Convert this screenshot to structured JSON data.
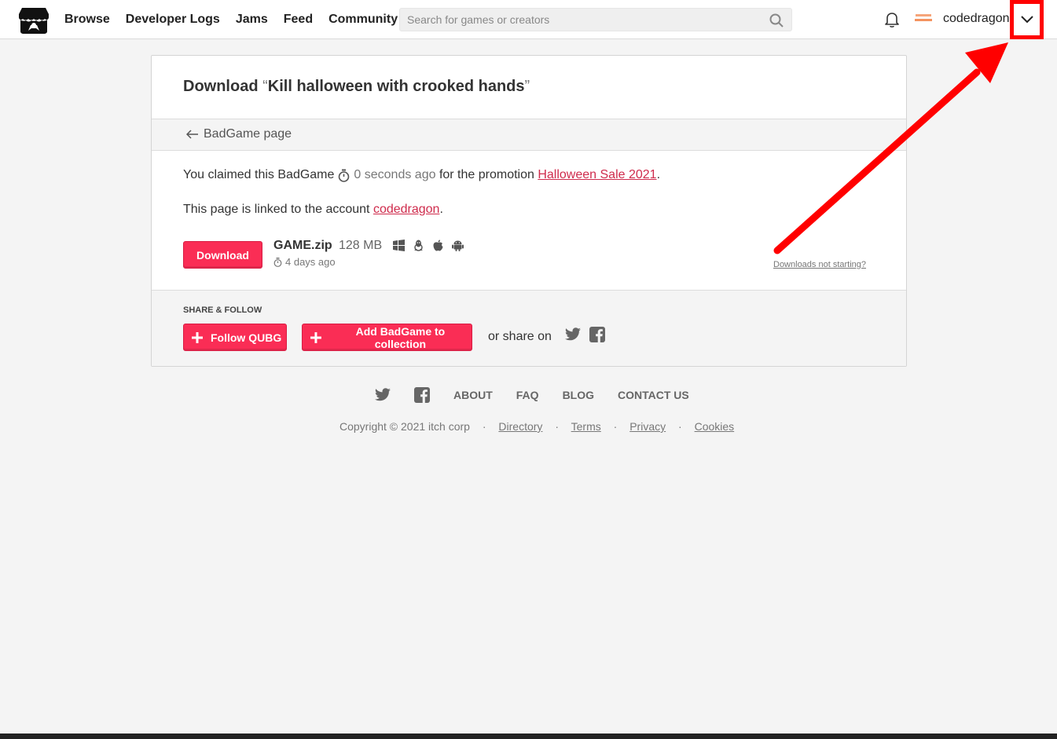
{
  "nav": {
    "items": [
      {
        "label": "Browse"
      },
      {
        "label": "Developer Logs"
      },
      {
        "label": "Jams"
      },
      {
        "label": "Feed"
      },
      {
        "label": "Community"
      }
    ]
  },
  "search": {
    "placeholder": "Search for games or creators"
  },
  "user": {
    "name": "codedragon"
  },
  "page": {
    "title_prefix": "Download ",
    "open_quote": "“",
    "game_title": "Kill halloween with crooked hands",
    "close_quote": "”",
    "back_link": "BadGame page",
    "claim_text_1": "You claimed this BadGame",
    "claim_time": "0 seconds ago",
    "claim_text_2": "for the promotion",
    "promotion": "Halloween Sale 2021",
    "period": ".",
    "linked_text": "This page is linked to the account",
    "linked_account": "codedragon",
    "download_label": "Download",
    "file_name": "GAME.zip",
    "file_size": "128 MB",
    "file_date": "4 days ago",
    "platforms": [
      "windows-icon",
      "linux-icon",
      "apple-icon",
      "android-icon"
    ],
    "downloads_not_starting": "Downloads not starting?"
  },
  "share": {
    "title": "SHARE & FOLLOW",
    "follow_label": "Follow QUBG",
    "collection_label": "Add BadGame to collection",
    "share_on": "or share on"
  },
  "footer": {
    "links": [
      "ABOUT",
      "FAQ",
      "BLOG",
      "CONTACT US"
    ],
    "copyright": "Copyright © 2021 itch corp",
    "bottom_links": [
      "Directory",
      "Terms",
      "Privacy",
      "Cookies"
    ]
  },
  "colors": {
    "accent": "#fa2d55",
    "link": "#cf2b4c",
    "annotation": "#ff0000"
  }
}
